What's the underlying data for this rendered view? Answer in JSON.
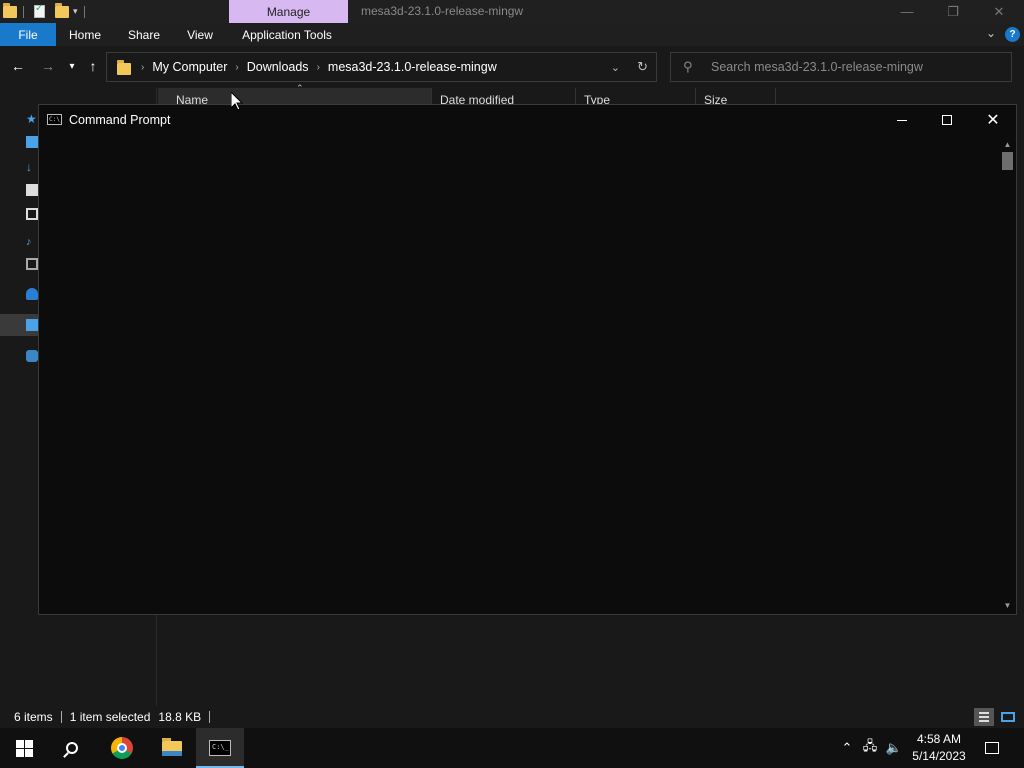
{
  "explorer": {
    "title": "mesa3d-23.1.0-release-mingw",
    "manage_tab": "Manage",
    "ribbon_tabs": [
      "File",
      "Home",
      "Share",
      "View",
      "Application Tools"
    ],
    "breadcrumbs": [
      "My Computer",
      "Downloads",
      "mesa3d-23.1.0-release-mingw"
    ],
    "search_placeholder": "Search mesa3d-23.1.0-release-mingw",
    "columns": [
      "Name",
      "Date modified",
      "Type",
      "Size"
    ],
    "status": {
      "items": "6 items",
      "selected": "1 item selected",
      "size": "18.8 KB"
    }
  },
  "cmd": {
    "title": "Command Prompt",
    "icon_text": "C:\\_"
  },
  "taskbar": {
    "time": "4:58 AM",
    "date": "5/14/2023"
  },
  "colors": {
    "accent": "#1979ca",
    "manage_tab": "#d7b8f0",
    "background": "#191919",
    "console": "#0c0c0c"
  }
}
